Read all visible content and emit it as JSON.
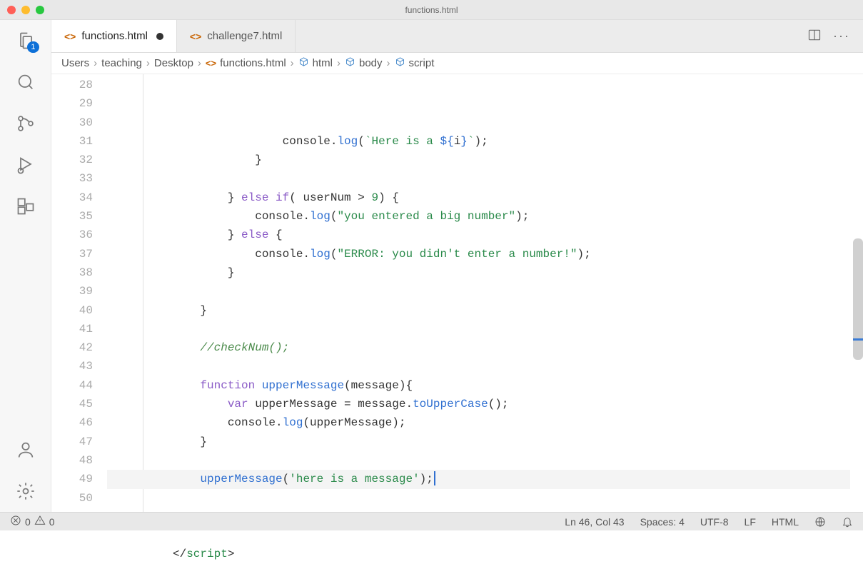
{
  "window": {
    "title": "functions.html"
  },
  "activity_bar": {
    "explorer_badge": "1"
  },
  "tabs": [
    {
      "label": "functions.html",
      "dirty": true,
      "active": true
    },
    {
      "label": "challenge7.html",
      "dirty": false,
      "active": false
    }
  ],
  "breadcrumb": [
    {
      "label": "Users",
      "kind": "folder"
    },
    {
      "label": "teaching",
      "kind": "folder"
    },
    {
      "label": "Desktop",
      "kind": "folder"
    },
    {
      "label": "functions.html",
      "kind": "file"
    },
    {
      "label": "html",
      "kind": "symbol"
    },
    {
      "label": "body",
      "kind": "symbol"
    },
    {
      "label": "script",
      "kind": "symbol"
    }
  ],
  "editor": {
    "first_line": 28,
    "current_line_highlight": 46,
    "lines": [
      {
        "n": 28,
        "html": "                console.<span class='tok-fn'>log</span>(<span class='tok-str'>`Here is a </span><span class='tok-tmpl'>${</span>i<span class='tok-tmpl'>}</span><span class='tok-str'>`</span>);"
      },
      {
        "n": 29,
        "html": "            }"
      },
      {
        "n": 30,
        "html": ""
      },
      {
        "n": 31,
        "html": "        } <span class='tok-kw'>else</span> <span class='tok-kw'>if</span>( userNum &gt; <span class='tok-num'>9</span>) {"
      },
      {
        "n": 32,
        "html": "            console.<span class='tok-fn'>log</span>(<span class='tok-str'>\"you entered a big number\"</span>);"
      },
      {
        "n": 33,
        "html": "        } <span class='tok-kw'>else</span> {"
      },
      {
        "n": 34,
        "html": "            console.<span class='tok-fn'>log</span>(<span class='tok-str'>\"ERROR: you didn't enter a number!\"</span>);"
      },
      {
        "n": 35,
        "html": "        }"
      },
      {
        "n": 36,
        "html": ""
      },
      {
        "n": 37,
        "html": "    }"
      },
      {
        "n": 38,
        "html": ""
      },
      {
        "n": 39,
        "html": "    <span class='tok-comment'>//checkNum();</span>"
      },
      {
        "n": 40,
        "html": ""
      },
      {
        "n": 41,
        "html": "    <span class='tok-kw'>function</span> <span class='tok-fn'>upperMessage</span>(message){"
      },
      {
        "n": 42,
        "html": "        <span class='tok-kw'>var</span> upperMessage = message.<span class='tok-fn'>toUpperCase</span>();"
      },
      {
        "n": 43,
        "html": "        console.<span class='tok-fn'>log</span>(upperMessage);"
      },
      {
        "n": 44,
        "html": "    }"
      },
      {
        "n": 45,
        "html": ""
      },
      {
        "n": 46,
        "html": "    <span class='tok-fn'>upperMessage</span>(<span class='tok-str'>'here is a message'</span>);<span class='cursor'></span>"
      },
      {
        "n": 47,
        "html": ""
      },
      {
        "n": 48,
        "html": ""
      },
      {
        "n": 49,
        "html": ""
      },
      {
        "n": 50,
        "html": "&lt;/<span class='tok-tag'>script</span>&gt;"
      }
    ]
  },
  "status": {
    "errors": "0",
    "warnings": "0",
    "cursor": "Ln 46, Col 43",
    "spaces": "Spaces: 4",
    "encoding": "UTF-8",
    "eol": "LF",
    "language": "HTML"
  }
}
